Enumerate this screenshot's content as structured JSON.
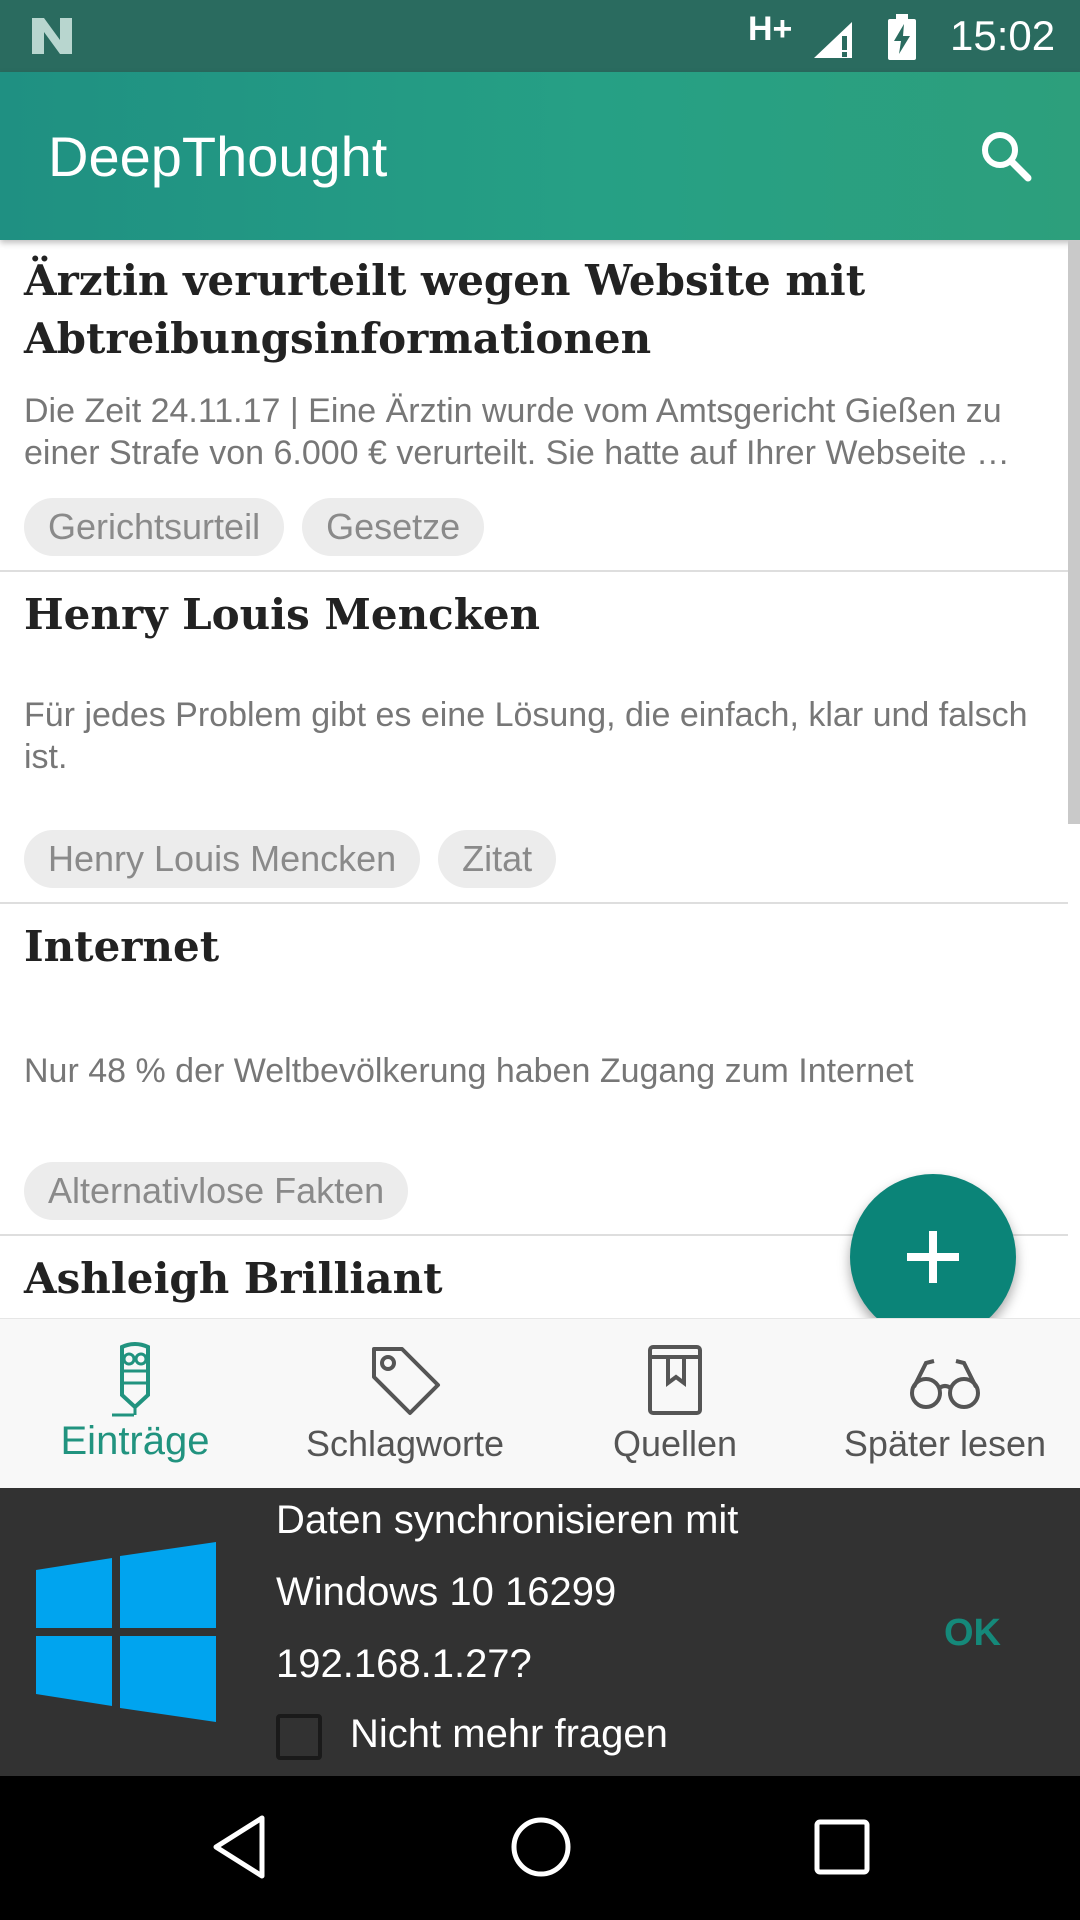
{
  "statusbar": {
    "network": "H+",
    "time": "15:02"
  },
  "appbar": {
    "title": "DeepThought"
  },
  "entries": [
    {
      "title": "Ärztin verurteilt wegen Website mit Abtreibungsinformationen",
      "preview": "Die Zeit 24.11.17 | Eine Ärztin wurde vom Amtsgericht Gießen zu einer Strafe von 6.000 € verurteilt. Sie hatte auf Ihrer Webseite …",
      "tags": [
        "Gerichtsurteil",
        "Gesetze"
      ]
    },
    {
      "title": "Henry Louis Mencken",
      "preview": "Für jedes Problem gibt es eine Lösung, die einfach, klar und falsch ist.",
      "tags": [
        "Henry Louis Mencken",
        "Zitat"
      ]
    },
    {
      "title": "Internet",
      "preview": "Nur 48 % der Weltbevölkerung haben Zugang zum Internet",
      "tags": [
        "Alternativlose Fakten"
      ]
    },
    {
      "title": "Ashleigh Brilliant",
      "preview": "",
      "tags": []
    }
  ],
  "bottom_nav": {
    "items": [
      {
        "label": "Einträge",
        "icon": "owl-pen-icon",
        "active": true
      },
      {
        "label": "Schlagworte",
        "icon": "tag-icon",
        "active": false
      },
      {
        "label": "Quellen",
        "icon": "book-icon",
        "active": false
      },
      {
        "label": "Später lesen",
        "icon": "glasses-icon",
        "active": false
      }
    ]
  },
  "sync_prompt": {
    "line1": "Daten synchronisieren mit",
    "line2": "Windows 10 16299",
    "line3": "192.168.1.27?",
    "ok_label": "OK",
    "checkbox_label": "Nicht mehr fragen",
    "checkbox_checked": false
  },
  "colors": {
    "appbar": "#26a085",
    "accent": "#0b8478",
    "active_nav": "#21937f",
    "windows_blue": "#00a4ef"
  }
}
